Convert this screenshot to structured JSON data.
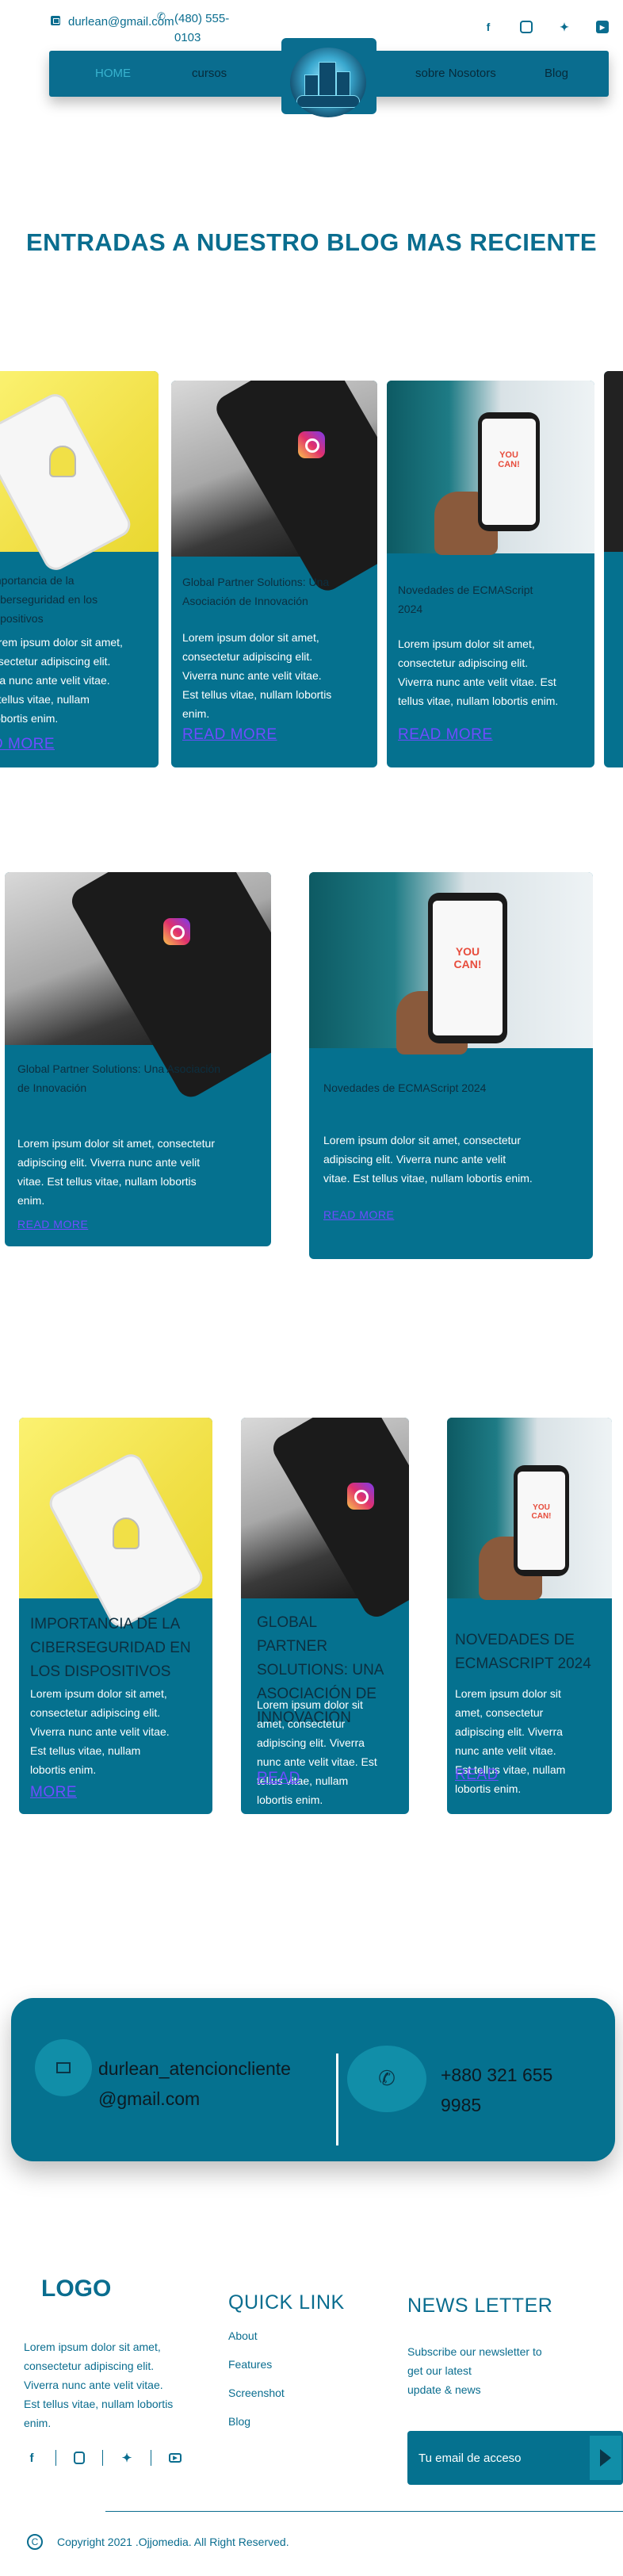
{
  "header": {
    "email": "durlean@gmail.com",
    "phone": "(480) 555-0103",
    "socials": [
      "facebook-icon",
      "instagram-icon",
      "twitter-icon",
      "youtube-icon"
    ]
  },
  "nav": {
    "items": [
      "HOME",
      "cursos",
      "sobre Nosotors",
      "Blog"
    ]
  },
  "blog": {
    "title": "ENTRADAS A NUESTRO BLOG MAS RECIENTE",
    "row1": [
      {
        "title": "mportancia de la\nciberseguridad en los\nispositivos",
        "text": "orem ipsum dolor sit amet,\nnsectetur adipiscing elit.\nrra nunc ante velit vitae.\nt tellus vitae, nullam\nlobortis enim.",
        "more": "D MORE"
      },
      {
        "title": "Global Partner Solutions: Una\nAsociación de Innovación",
        "text": "Lorem ipsum dolor sit amet,\nconsectetur adipiscing elit.\nViverra nunc ante velit vitae.\nEst tellus vitae, nullam lobortis\nenim.",
        "more": "READ MORE"
      },
      {
        "title": "Novedades de ECMAScript\n2024",
        "text": "Lorem ipsum dolor sit amet,\nconsectetur adipiscing elit.\nViverra nunc ante velit vitae. Est\ntellus vitae, nullam lobortis enim.",
        "more": "READ MORE"
      }
    ],
    "row2": [
      {
        "title": "Global Partner Solutions: Una Asociación\nde Innovación",
        "text": "Lorem ipsum dolor sit amet, consectetur\nadipiscing elit. Viverra nunc ante velit\nvitae. Est tellus vitae, nullam lobortis\nenim.",
        "more": "READ MORE"
      },
      {
        "title": "Novedades de ECMAScript 2024",
        "text": "Lorem ipsum dolor sit amet, consectetur\nadipiscing elit. Viverra nunc ante velit\nvitae. Est tellus vitae, nullam lobortis enim.",
        "more": "READ MORE"
      }
    ],
    "row3": [
      {
        "title": "IMPORTANCIA DE LA\nCIBERSEGURIDAD EN\nLOS DISPOSITIVOS",
        "text": "Lorem ipsum dolor sit amet,\nconsectetur adipiscing elit.\nViverra nunc ante velit vitae.\nEst tellus vitae, nullam\nlobortis enim.",
        "more": "MORE"
      },
      {
        "title": "GLOBAL\nPARTNER\nSOLUTIONS: UNA\nASOCIACIÓN DE\nINNOVACIÓN",
        "text": "Lorem ipsum dolor sit\namet, consectetur\nadipiscing elit. Viverra\nnunc ante velit vitae. Est\ntellus vitae, nullam\nlobortis enim.",
        "more": "READ"
      },
      {
        "title": "NOVEDADES DE\nECMASCRIPT 2024",
        "text": "Lorem ipsum dolor sit\namet, consectetur\nadipiscing elit. Viverra\nnunc ante velit vitae.\nEst tellus vitae, nullam\nlobortis enim.",
        "more": "READ"
      }
    ]
  },
  "banner": {
    "email": "durlean_atencioncliente\n@gmail.com",
    "phone": "+880 321 655\n9985"
  },
  "footer": {
    "logo": "LOGO",
    "description": "Lorem ipsum dolor sit amet,\nconsectetur adipiscing elit.\nViverra nunc ante velit vitae.\nEst tellus vitae, nullam lobortis\nenim.",
    "quick_link_title": "QUICK LINK",
    "quick_links": [
      "About",
      "Features",
      "Screenshot",
      "Blog"
    ],
    "newsletter_title": "NEWS LETTER",
    "newsletter_text": "Subscribe our newsletter to\nget our latest\nupdate & news",
    "email_placeholder": "Tu email de acceso",
    "copyright_symbol": "C",
    "copyright": "Copyright 2021 .Ojjomedia. All Right Reserved."
  },
  "colors": {
    "primary": "#0a6d8f",
    "card": "#05718f",
    "accent": "#118ea8",
    "link": "#6f4bff"
  }
}
